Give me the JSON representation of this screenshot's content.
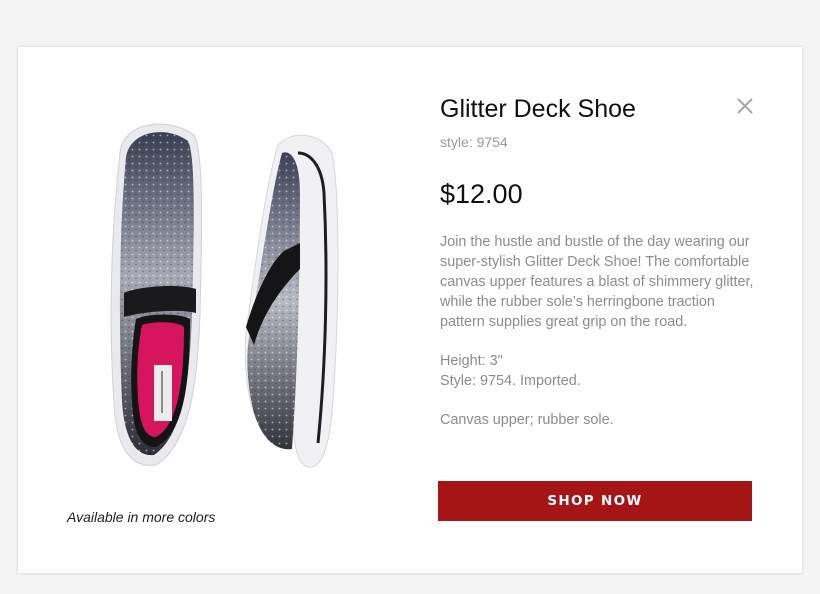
{
  "modal": {
    "title": "Glitter Deck Shoe",
    "style": "style: 9754",
    "price": "$12.00",
    "description": [
      "Join the hustle and bustle of the day wearing our super-stylish Glitter Deck Shoe! The com­fortable canvas upper features a blast of shim­mery glitter, while the rubber sole’s herringbone traction pattern supplies great grip on the road.",
      "Height: 3\"",
      "Style: 9754. Imported.",
      "Canvas upper; rubber sole."
    ],
    "more_colors": "Available in more colors",
    "shop_button": "SHOP NOW",
    "close_icon": "close-icon",
    "product_image": "glitter-slip-on-shoes-image",
    "colors": {
      "button": "#a51516",
      "text_muted": "#8c8c8c",
      "background": "#f4f4f4"
    }
  }
}
